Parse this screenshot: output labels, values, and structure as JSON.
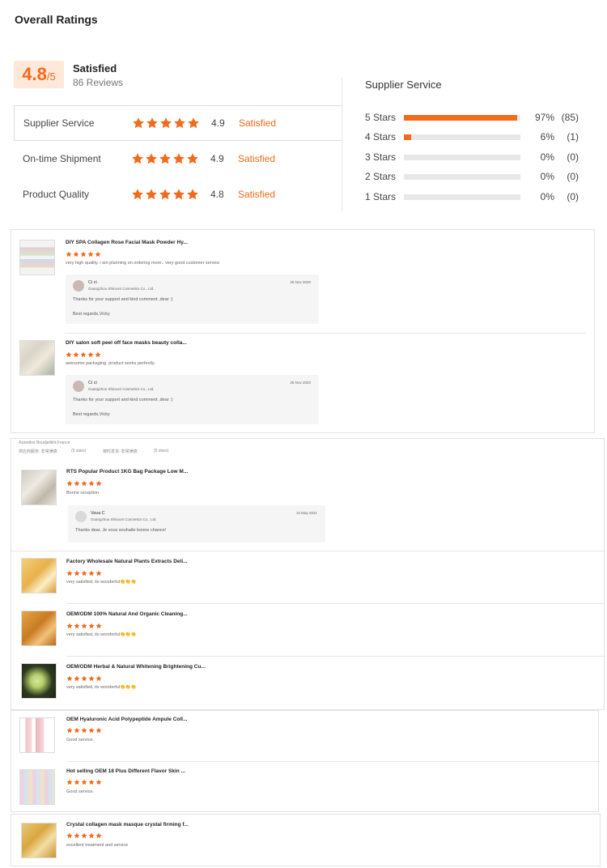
{
  "header": {
    "title": "Overall Ratings"
  },
  "overall": {
    "score": "4.8",
    "out_of": "/5",
    "label": "Satisfied",
    "reviews": "86 Reviews"
  },
  "categories": [
    {
      "label": "Supplier Service",
      "score": "4.9",
      "status": "Satisfied",
      "stars": 5
    },
    {
      "label": "On-time Shipment",
      "score": "4.9",
      "status": "Satisfied",
      "stars": 5
    },
    {
      "label": "Product Quality",
      "score": "4.8",
      "status": "Satisfied",
      "stars": 5
    }
  ],
  "distribution": {
    "title": "Supplier Service",
    "rows": [
      {
        "label": "5 Stars",
        "pct": "97%",
        "count": "(85)",
        "fraction": 0.97
      },
      {
        "label": "4 Stars",
        "pct": "6%",
        "count": "(1)",
        "fraction": 0.06
      },
      {
        "label": "3 Stars",
        "pct": "0%",
        "count": "(0)",
        "fraction": 0
      },
      {
        "label": "2 Stars",
        "pct": "0%",
        "count": "(0)",
        "fraction": 0
      },
      {
        "label": "1 Stars",
        "pct": "0%",
        "count": "(0)",
        "fraction": 0
      }
    ]
  },
  "panel1": {
    "reviews": [
      {
        "title": "DIY SPA Collagen Rose Facial Mask Powder Hy...",
        "text": "very high quality. i am planning on ordering more.. very good customer service",
        "reply": {
          "name": "Ci ci",
          "company": "Guangzhou Shiruoni Cosmetics Co., Ltd.",
          "date": "25 Nov 2020",
          "msg": "Thanks for your support and kind comment ,dear :)",
          "msg2": "Best regards,Vicky"
        }
      },
      {
        "title": "DIY salon soft peel off face masks beauty colla...",
        "text": "awesome packaging. product works perfectly.",
        "reply": {
          "name": "Ci ci",
          "company": "Guangzhou Shiruoni Cosmetics Co., Ltd.",
          "date": "25 Nov 2020",
          "msg": "Thanks for your support and kind comment ,dear :)",
          "msg2": "Best regards,Vicky"
        }
      }
    ]
  },
  "panel2": {
    "reviewer": "Azzedine Boudjellkht,France",
    "meta1": "供应商服务: 非常满意",
    "meta1b": "(5 stars)",
    "meta2": "按时发货: 非常满意",
    "meta2b": "(5 stars)",
    "reviews": [
      {
        "title": "RTS Popular Product 1KG Bag Package Low M...",
        "text": "Bonne reception.",
        "reply": {
          "name": "Vava C",
          "company": "Guangzhou Shiruoni Cosmetics Co., Ltd.",
          "date": "10 May 2021",
          "msg": "Thanks dear, Je vous souhaite bonne chance!"
        }
      },
      {
        "title": "Factory Wholesale Natural Plants Extracts Deli...",
        "text": "very satisfied, its wonderful👏👏👏"
      },
      {
        "title": "OEM/ODM 100% Natural And Organic Cleaning...",
        "text": "very satisfied, its wonderful👏👏👏"
      },
      {
        "title": "OEM/ODM Herbal & Natural Whitening Brightening Cu...",
        "text": "very satisfied, its wonderful👏👏👏"
      }
    ]
  },
  "panel3": {
    "reviews": [
      {
        "title": "OEM Hyaluronic Acid Polypeptide Ampule Coll...",
        "text": "Good service."
      },
      {
        "title": "Hot selling OEM 18 Plus Different Flavor Skin ...",
        "text": "Good service."
      }
    ]
  },
  "panel4": {
    "reviews": [
      {
        "title": "Crystal collagen mask masque crystal firming f...",
        "text": "excellent treatment and service"
      }
    ]
  },
  "colors": {
    "accent": "#f26a1b",
    "accent_light": "#fde8d9",
    "track": "#e8e8e8"
  }
}
